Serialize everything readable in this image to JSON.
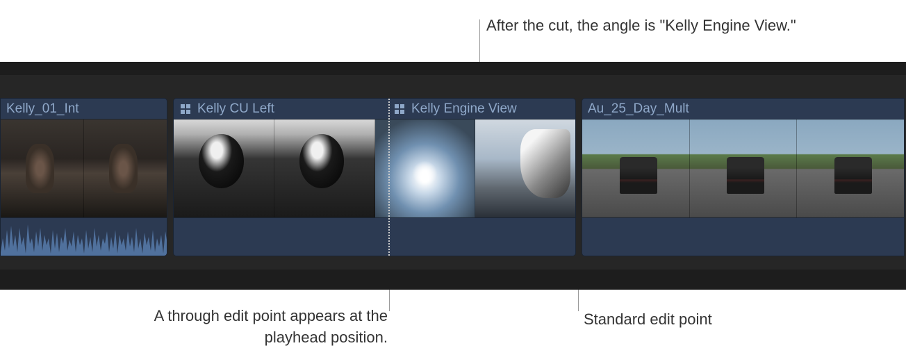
{
  "annotations": {
    "top": "After the cut, the angle is \"Kelly Engine View.\"",
    "bottom_left": "A through edit point appears at the playhead position.",
    "bottom_right": "Standard edit point"
  },
  "timeline": {
    "clips": [
      {
        "name": "Kelly_01_Int",
        "is_multicam": false
      },
      {
        "name": "Kelly CU Left",
        "is_multicam": true
      },
      {
        "name": "Kelly Engine View",
        "is_multicam": true
      },
      {
        "name": "Au_25_Day_Mult",
        "is_multicam": false
      }
    ]
  }
}
